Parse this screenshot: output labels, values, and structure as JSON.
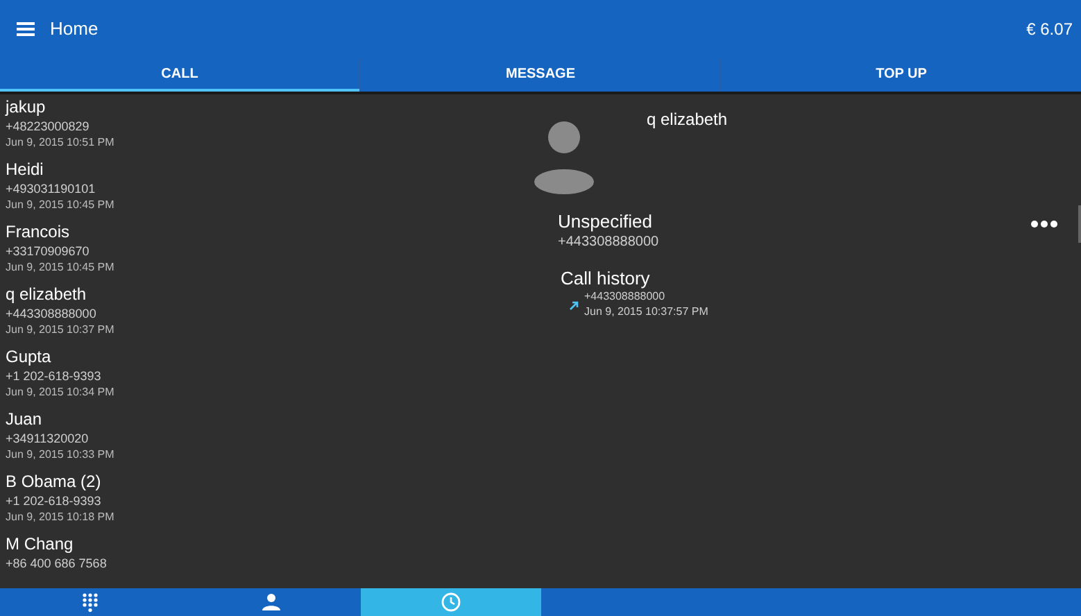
{
  "app_bar": {
    "title": "Home",
    "balance": "€ 6.07"
  },
  "tabs": [
    {
      "label": "CALL",
      "selected": true
    },
    {
      "label": "MESSAGE",
      "selected": false
    },
    {
      "label": "TOP UP",
      "selected": false
    }
  ],
  "contacts": [
    {
      "name": "jakup",
      "number": "+48223000829",
      "time": "Jun 9, 2015 10:51 PM"
    },
    {
      "name": "Heidi",
      "number": "+493031190101",
      "time": "Jun 9, 2015 10:45 PM"
    },
    {
      "name": "Francois",
      "number": "+33170909670",
      "time": "Jun 9, 2015 10:45 PM"
    },
    {
      "name": "q elizabeth",
      "number": "+443308888000",
      "time": "Jun 9, 2015 10:37 PM"
    },
    {
      "name": "Gupta",
      "number": "+1 202-618-9393",
      "time": "Jun 9, 2015 10:34 PM"
    },
    {
      "name": "Juan",
      "number": "+34911320020",
      "time": "Jun 9, 2015 10:33 PM"
    },
    {
      "name": "B Obama  (2)",
      "number": "+1 202-618-9393",
      "time": "Jun 9, 2015 10:18 PM"
    },
    {
      "name": "M Chang",
      "number": "+86 400 686 7568"
    }
  ],
  "detail": {
    "name": "q elizabeth",
    "number_type": "Unspecified",
    "number": "+443308888000",
    "history_title": "Call history",
    "history": [
      {
        "number": "+443308888000",
        "time": "Jun 9, 2015 10:37:57 PM"
      }
    ]
  },
  "bottom_nav": [
    {
      "kind": "dialpad",
      "selected": false
    },
    {
      "kind": "contacts",
      "selected": false
    },
    {
      "kind": "history",
      "selected": true
    }
  ]
}
